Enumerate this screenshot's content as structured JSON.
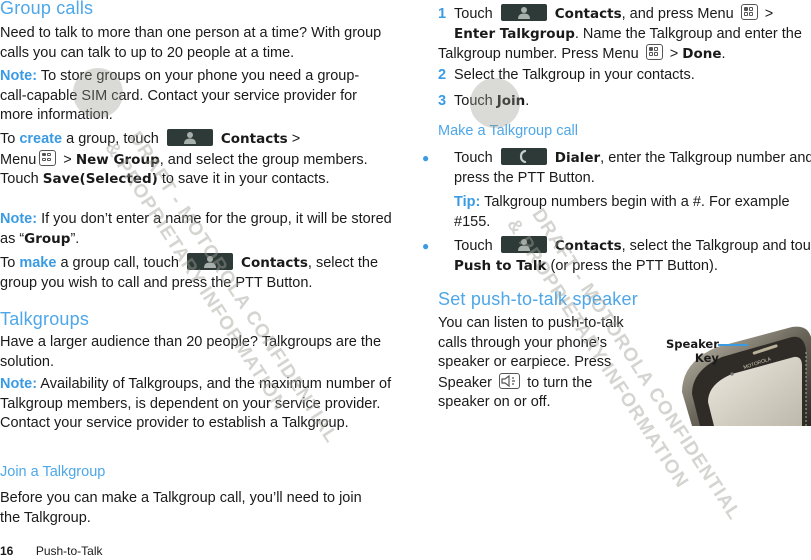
{
  "left": {
    "group_calls": {
      "title": "Group calls",
      "intro": "Need to talk to more than one person at a time? With group calls you can talk to up to 20 people at a time.",
      "note1_label": "Note:",
      "note1_text": " To store groups on your phone you need a group-call-capable SIM card. Contact your service provider for more information.",
      "create_prefix": "To ",
      "create_word": "create",
      "create_mid": " a group, touch ",
      "contacts_label": "Contacts",
      "create_after_contacts": " >",
      "menu_label": "Menu",
      "new_group": "New Group",
      "create_after_new_group": ", and select the group members. Touch ",
      "save_selected": "Save(Selected)",
      "create_end": " to save it in your contacts.",
      "note2_label": "Note:",
      "note2_text": " If you don’t enter a name for the group, it will be stored as “",
      "note2_group": "Group",
      "note2_end": "”.",
      "make_prefix": "To ",
      "make_word": "make",
      "make_mid": " a group call, touch ",
      "make_end": ", select the group you wish to call and press the PTT Button."
    },
    "talkgroups": {
      "title": "Talkgroups",
      "intro": "Have a larger audience than 20 people? Talkgroups are the solution.",
      "note_label": "Note:",
      "note_text": " Availability of Talkgroups, and the maximum number of Talkgroup members, is dependent on your service provider. Contact your service provider to establish a Talkgroup."
    },
    "join": {
      "title": "Join a Talkgroup",
      "text": "Before you can make a Talkgroup call, you’ll need to join the Talkgroup."
    }
  },
  "right": {
    "steps": [
      {
        "num": "1",
        "t1": "Touch ",
        "contacts": "Contacts",
        "t2": ", and press Menu ",
        "t3": " > ",
        "enter_tg": "Enter Talkgroup",
        "t4": ". Name the Talkgroup and enter the Talkgroup number. Press Menu ",
        "t5": " > ",
        "done": "Done",
        "t6": "."
      },
      {
        "num": "2",
        "text": "Select the Talkgroup in your contacts."
      },
      {
        "num": "3",
        "t1": "Touch ",
        "join": "Join",
        "t2": "."
      }
    ],
    "make_call": {
      "title": "Make a Talkgroup call",
      "bullet1_t1": "Touch ",
      "dialer": "Dialer",
      "bullet1_t2": ", enter the Talkgroup number and press the PTT Button.",
      "tip_label": "Tip:",
      "tip_text": " Talkgroup numbers begin with a #. For example #155.",
      "bullet2_t1": "Touch ",
      "contacts": "Contacts",
      "bullet2_t2": ", select the Talkgroup and touch ",
      "ptt": "Push to Talk",
      "bullet2_t3": " (or press the PTT Button)."
    },
    "speaker": {
      "title": "Set push-to-talk speaker",
      "text1": "You can listen to push-to-talk calls through your phone’s speaker or earpiece. Press Speaker ",
      "text2": " to turn the speaker on or off.",
      "callout_line1": "Speaker",
      "callout_line2": "Key"
    }
  },
  "footer": {
    "page_number": "16",
    "section": "Push-to-Talk"
  },
  "watermark": {
    "line1": "DRAFT - MOTOROLA CONFIDENTIAL",
    "line2": "& PROPRIETARY INFORMATION"
  },
  "icons": {
    "contacts": "person-icon",
    "dialer": "phone-handset-icon",
    "menu": "menu-key-icon",
    "speaker": "speaker-icon"
  },
  "colors": {
    "heading": "#4ea7e8",
    "accent": "#3a9be3",
    "icon_button": "#2d3a37"
  }
}
